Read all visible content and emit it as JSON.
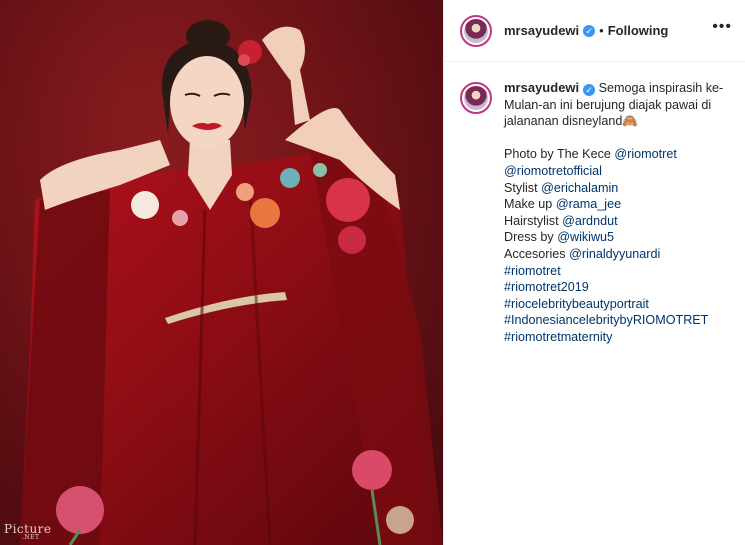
{
  "photo": {
    "description_icon": "portrait-photo",
    "watermark": "Picture",
    "watermark_sub": ".NET"
  },
  "header": {
    "username": "mrsayudewi",
    "separator": "•",
    "follow_status": "Following",
    "more_label": "•••"
  },
  "caption": {
    "username": "mrsayudewi",
    "text_line1": "Semoga inspirasih ke-",
    "text_line2": "Mulan-an ini berujung diajak pawai di",
    "text_line3": "jalananan disneyland🙈",
    "credits": [
      {
        "label": "Photo by The Kece ",
        "link": "@riomotret"
      },
      {
        "label": "",
        "link": "@riomotretofficial"
      },
      {
        "label": "Stylist ",
        "link": "@erichalamin"
      },
      {
        "label": "Make up ",
        "link": "@rama_jee"
      },
      {
        "label": "Hairstylist ",
        "link": "@ardndut"
      },
      {
        "label": "Dress by ",
        "link": "@wikiwu5"
      },
      {
        "label": "Accesories ",
        "link": "@rinaldyyunardi"
      }
    ],
    "hashtags": [
      "#riomotret",
      "#riomotret2019",
      "#riocelebritybeautyportrait",
      "#IndonesiancelebritybyRIOMOTRET",
      "#riomotretmaternity"
    ]
  },
  "colors": {
    "link": "#003569",
    "verified": "#3897f0",
    "photo_bg": "#6f1217"
  }
}
